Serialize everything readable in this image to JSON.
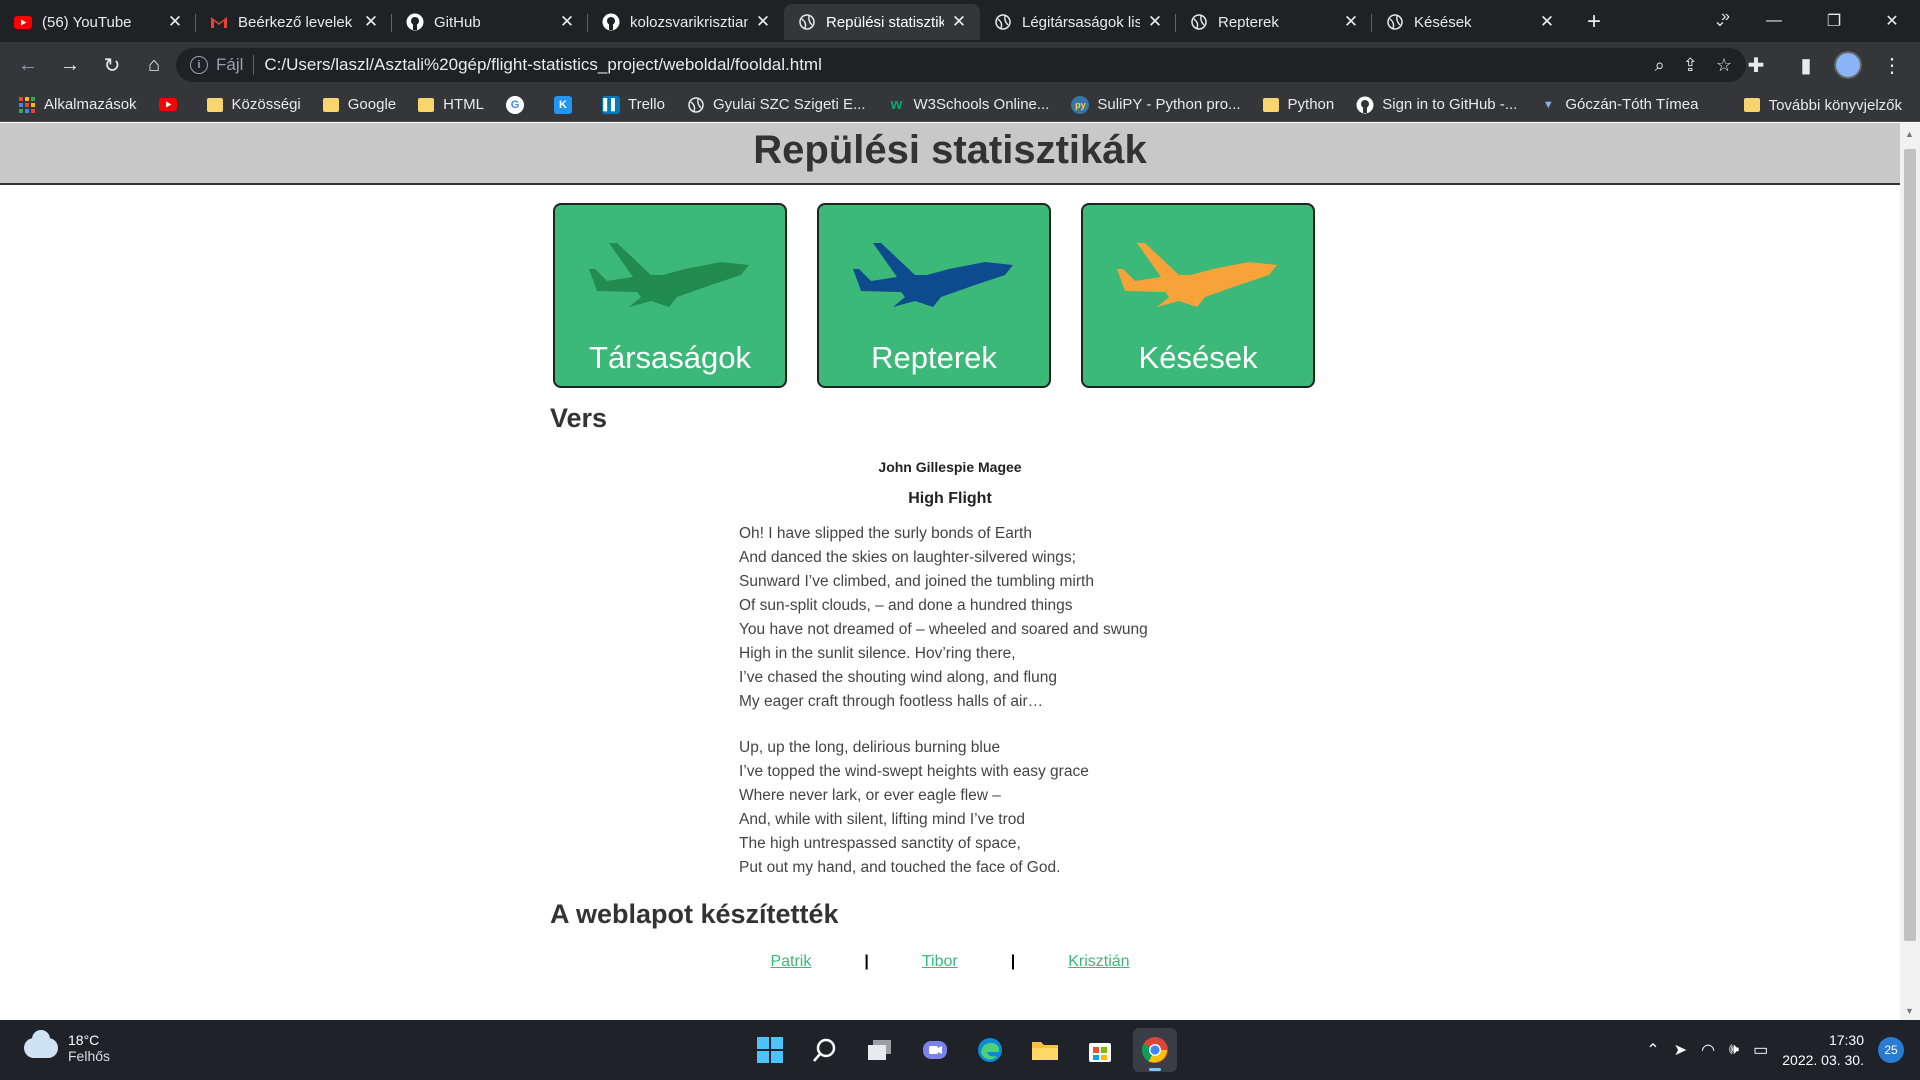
{
  "browser": {
    "tabs": [
      {
        "title": "(56) YouTube",
        "icon": "youtube-icon"
      },
      {
        "title": "Beérkező levelek (",
        "icon": "gmail-icon"
      },
      {
        "title": "GitHub",
        "icon": "github-icon"
      },
      {
        "title": "kolozsvarikrisztian",
        "icon": "github-icon"
      },
      {
        "title": "Repülési statisztik",
        "icon": "globe-icon",
        "active": true
      },
      {
        "title": "Légitársaságok lis",
        "icon": "globe-icon"
      },
      {
        "title": "Repterek",
        "icon": "globe-icon"
      },
      {
        "title": "Késések",
        "icon": "globe-icon"
      }
    ],
    "address": {
      "scheme": "Fájl",
      "url": "C:/Users/laszl/Asztali%20gép/flight-statistics_project/weboldal/fooldal.html"
    },
    "bookmarks": [
      {
        "label": "Alkalmazások",
        "icon": "apps-grid-icon"
      },
      {
        "label": "",
        "icon": "youtube-icon"
      },
      {
        "label": "Közösségi",
        "icon": "folder-icon"
      },
      {
        "label": "Google",
        "icon": "folder-icon"
      },
      {
        "label": "HTML",
        "icon": "folder-icon"
      },
      {
        "label": "",
        "icon": "google-icon"
      },
      {
        "label": "",
        "icon": "k-app-icon"
      },
      {
        "label": "Trello",
        "icon": "trello-icon"
      },
      {
        "label": "Gyulai SZC Szigeti E...",
        "icon": "globe-icon"
      },
      {
        "label": "W3Schools Online...",
        "icon": "w3schools-icon"
      },
      {
        "label": "SuliPY - Python pro...",
        "icon": "python-icon"
      },
      {
        "label": "Python",
        "icon": "folder-icon"
      },
      {
        "label": "Sign in to GitHub -...",
        "icon": "github-icon"
      },
      {
        "label": "Góczán-Tóth Tímea",
        "icon": "wolf-icon"
      }
    ],
    "bookmarks_more": "»",
    "other_bookmarks": "További könyvjelzők"
  },
  "page": {
    "title": "Repülési statisztikák",
    "cards": [
      {
        "label": "Társaságok",
        "plane_color": "#228b4f"
      },
      {
        "label": "Repterek",
        "plane_color": "#0d4a8e"
      },
      {
        "label": "Késések",
        "plane_color": "#f7a33a"
      }
    ],
    "poem_heading": "Vers",
    "poem": {
      "author": "John Gillespie Magee",
      "title": "High Flight",
      "stanza1": [
        "Oh! I have slipped the surly bonds of Earth",
        "And danced the skies on laughter-silvered wings;",
        "Sunward I’ve climbed, and joined the tumbling mirth",
        "Of sun-split clouds, – and done a hundred things",
        "You have not dreamed of – wheeled and soared and swung",
        "High in the sunlit silence. Hov’ring there,",
        "I’ve chased the shouting wind along, and flung",
        "My eager craft through footless halls of air…"
      ],
      "stanza2": [
        "Up, up the long, delirious burning blue",
        "I’ve topped the wind-swept heights with easy grace",
        "Where never lark, or ever eagle flew –",
        "And, while with silent, lifting mind I’ve trod",
        "The high untrespassed sanctity of space,",
        "Put out my hand, and touched the face of God."
      ]
    },
    "authors_heading": "A weblapot készítették",
    "authors": [
      "Patrik",
      "Tibor",
      "Krisztián"
    ],
    "author_separator": "|"
  },
  "taskbar": {
    "weather_temp": "18°C",
    "weather_desc": "Felhős",
    "time": "17:30",
    "date": "2022. 03. 30.",
    "notifications": "25"
  },
  "colors": {
    "card_green": "#3cb878",
    "header_gray": "#c8c8c8",
    "link_green": "#3cb878"
  }
}
